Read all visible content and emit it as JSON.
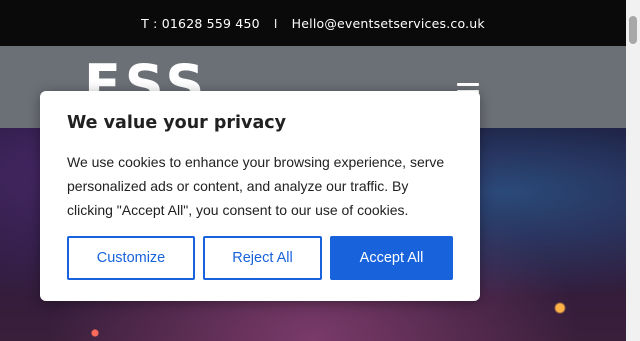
{
  "topbar": {
    "phone": "T : 01628 559 450",
    "separator": "I",
    "email": "Hello@eventsetservices.co.uk"
  },
  "header": {
    "logo_text": "ESS",
    "menu_icon": "hamburger-menu-icon"
  },
  "cookie_banner": {
    "title": "We value your privacy",
    "body": "We use cookies to enhance your browsing experience, serve personalized ads or content, and analyze our traffic. By clicking \"Accept All\", you consent to our use of cookies.",
    "customize_label": "Customize",
    "reject_label": "Reject All",
    "accept_label": "Accept All"
  },
  "colors": {
    "accent": "#1863dc",
    "topbar_bg": "#0a0a0a",
    "header_bg": "#6b7076"
  }
}
